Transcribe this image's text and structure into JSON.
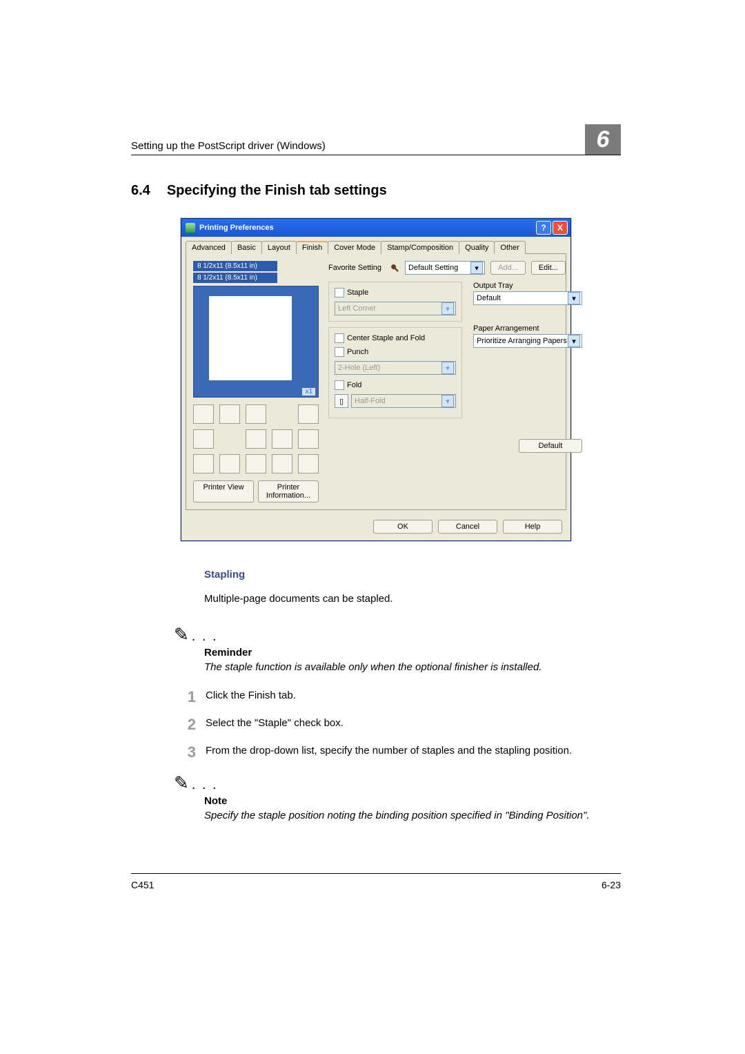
{
  "header": {
    "running_title": "Setting up the PostScript driver (Windows)",
    "chapter": "6"
  },
  "section": {
    "number": "6.4",
    "title": "Specifying the Finish tab settings"
  },
  "dialog": {
    "title": "Printing Preferences",
    "tabs": [
      "Advanced",
      "Basic",
      "Layout",
      "Finish",
      "Cover Mode",
      "Stamp/Composition",
      "Quality",
      "Other"
    ],
    "active_tab": "Finish",
    "preview": {
      "label1": "8 1/2x11 (8.5x11 in)",
      "label2": "8 1/2x11 (8.5x11 in)",
      "zoom": "x1"
    },
    "favorite": {
      "label": "Favorite Setting",
      "value": "Default Setting",
      "add_btn": "Add...",
      "edit_btn": "Edit..."
    },
    "finish_box": {
      "staple": "Staple",
      "staple_select": "Left Corner",
      "center": "Center Staple and Fold",
      "punch": "Punch",
      "punch_select": "2-Hole (Left)",
      "fold": "Fold",
      "fold_select": "Half-Fold"
    },
    "right": {
      "output_tray_label": "Output Tray",
      "output_tray_value": "Default",
      "paper_arr_label": "Paper Arrangement",
      "paper_arr_value": "Prioritize Arranging Papers"
    },
    "buttons": {
      "printer_view": "Printer View",
      "printer_info": "Printer Information...",
      "default": "Default",
      "ok": "OK",
      "cancel": "Cancel",
      "help": "Help"
    }
  },
  "body": {
    "sub1": "Stapling",
    "p1": "Multiple-page documents can be stapled.",
    "reminder_title": "Reminder",
    "reminder_body": "The staple function is available only when the optional finisher is installed.",
    "steps": [
      "Click the Finish tab.",
      "Select the \"Staple\" check box.",
      "From the drop-down list, specify the number of staples and the stapling position."
    ],
    "note_title": "Note",
    "note_body": "Specify the staple position noting the binding position specified in \"Binding Position\"."
  },
  "footer": {
    "model": "C451",
    "pageno": "6-23"
  }
}
